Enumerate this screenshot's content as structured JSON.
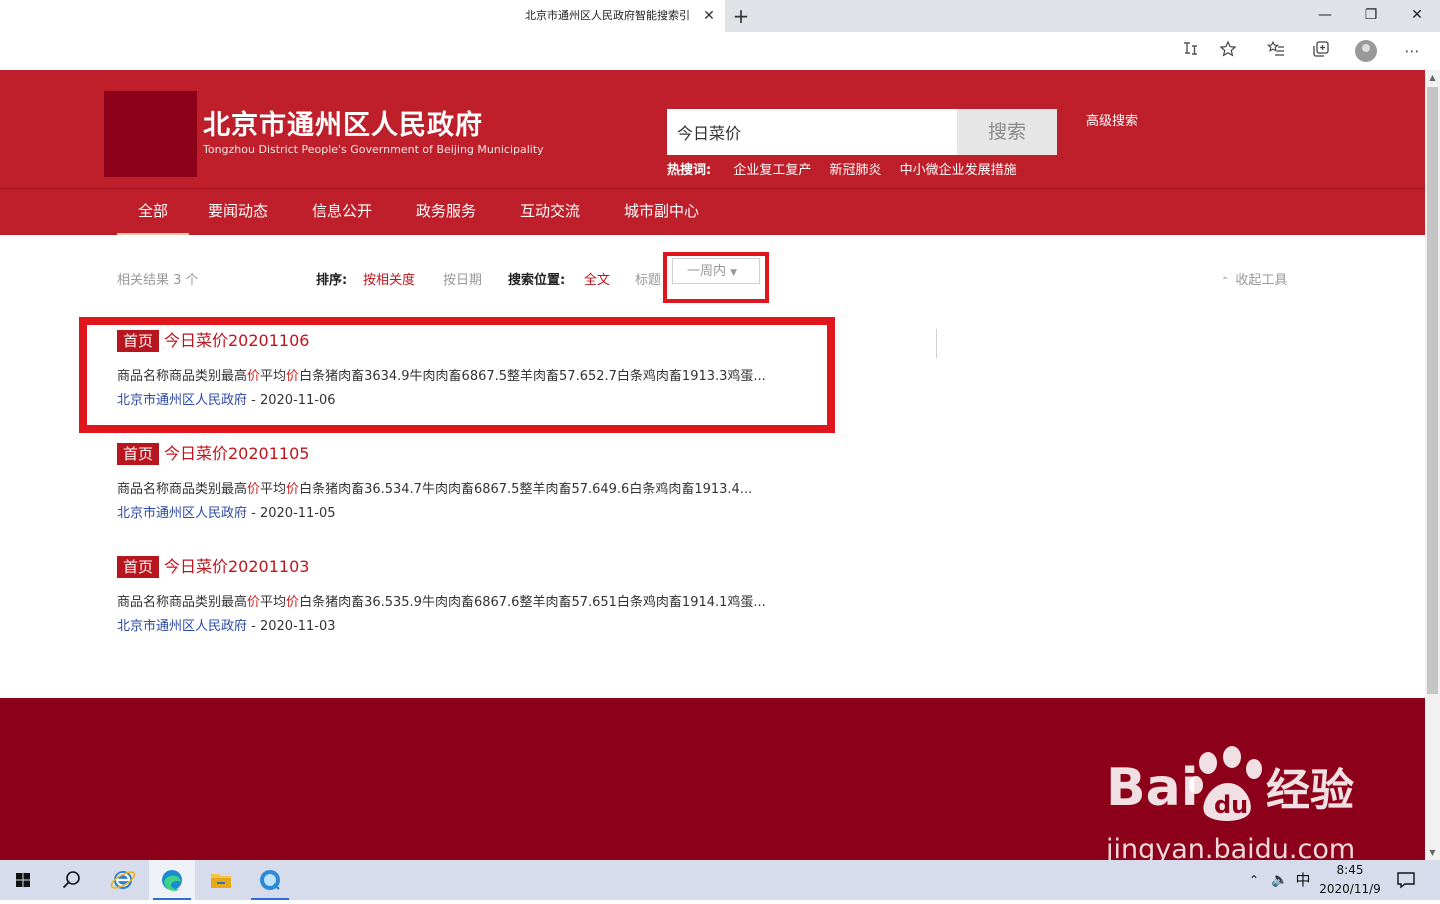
{
  "browser": {
    "tab_title": "北京市通州区人民政府智能搜索引",
    "tab_close": "✕",
    "new_tab": "+",
    "window_controls": {
      "minimize": "—",
      "restore": "❐",
      "close": "✕"
    },
    "toolbar_icons": [
      "read-aloud-icon",
      "favorite-star-icon",
      "favorites-icon",
      "collections-icon",
      "profile-avatar",
      "more-icon"
    ],
    "more": "⋯"
  },
  "header": {
    "site_title": "北京市通州区人民政府",
    "site_subtitle": "Tongzhou District People's Government of Beijing Municipality",
    "search_value": "今日菜价",
    "search_button": "搜索",
    "advanced_search": "高级搜索",
    "hot_label": "热搜词:",
    "hot_words": [
      "企业复工复产",
      "新冠肺炎",
      "中小微企业发展措施"
    ]
  },
  "nav": {
    "items": [
      "全部",
      "要闻动态",
      "信息公开",
      "政务服务",
      "互动交流",
      "城市副中心"
    ],
    "active_index": 0
  },
  "filters": {
    "result_count": "相关结果 3 个",
    "sort_label": "排序:",
    "sort_relevance": "按相关度",
    "sort_date": "按日期",
    "position_label": "搜索位置:",
    "position_fulltext": "全文",
    "position_title": "标题",
    "time_range": "一周内",
    "collapse_tools": "收起工具"
  },
  "results": [
    {
      "tag": "首页",
      "title": "今日菜价20201106",
      "snippet_parts": [
        "商品名称商品类别最高",
        "价",
        "平均",
        "价",
        "白条猪肉畜3634.9牛肉肉畜6867.5整羊肉畜57.652.7白条鸡肉畜1913.3鸡蛋..."
      ],
      "source": "北京市通州区人民政府",
      "date": "- 2020-11-06"
    },
    {
      "tag": "首页",
      "title": "今日菜价20201105",
      "snippet_parts": [
        "商品名称商品类别最高",
        "价",
        "平均",
        "价",
        "白条猪肉畜36.534.7牛肉肉畜6867.5整羊肉畜57.649.6白条鸡肉畜1913.4..."
      ],
      "source": "北京市通州区人民政府",
      "date": "- 2020-11-05"
    },
    {
      "tag": "首页",
      "title": "今日菜价20201103",
      "snippet_parts": [
        "商品名称商品类别最高",
        "价",
        "平均",
        "价",
        "白条猪肉畜36.535.9牛肉肉畜6867.6整羊肉畜57.651白条鸡肉畜1914.1鸡蛋..."
      ],
      "source": "北京市通州区人民政府",
      "date": "- 2020-11-03"
    }
  ],
  "watermark": {
    "brand": "Bai",
    "brand_cn": "经验",
    "url": "jingyan.baidu.com"
  },
  "taskbar": {
    "apps": [
      "windows-start-icon",
      "search-icon",
      "internet-explorer-icon",
      "edge-icon",
      "file-explorer-icon",
      "browser-app-icon"
    ],
    "ime": "中",
    "time": "8:45",
    "date": "2020/11/9"
  },
  "colors": {
    "header_red": "#be1f2b",
    "footer_red": "#8c0019",
    "highlight_red": "#e0161e",
    "link_blue": "#2b4aa6"
  }
}
